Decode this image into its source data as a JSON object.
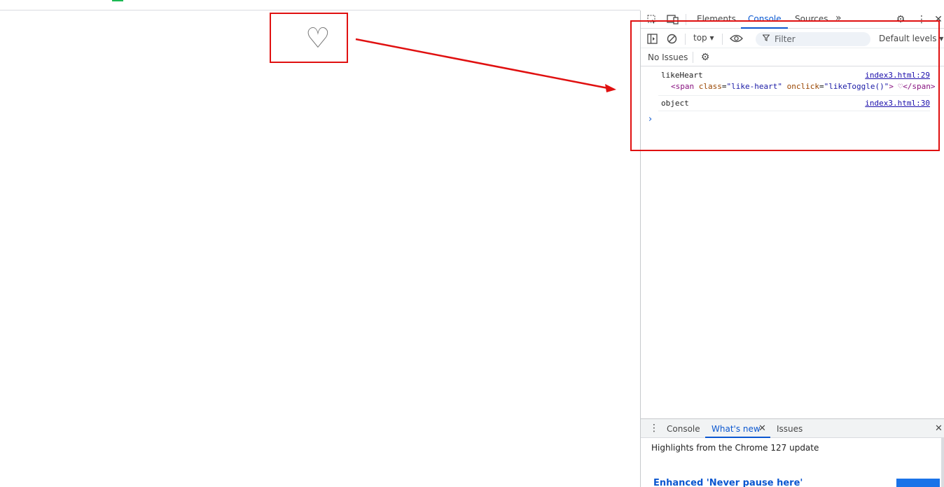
{
  "page": {
    "heart_glyph": "♡"
  },
  "devtools": {
    "tabs": [
      "Elements",
      "Console",
      "Sources"
    ],
    "active_tab": "Console",
    "more_tabs": "»",
    "toolbar": {
      "context": "top ▾",
      "filter_placeholder": "Filter",
      "levels": "Default levels ▾"
    },
    "issues_label": "No Issues",
    "messages": [
      {
        "text": "likeHeart",
        "source": "index3.html:29",
        "element": {
          "open_tag": "<span",
          "attr1_name": "class",
          "attr1_value": "\"like-heart\"",
          "attr2_name": "onclick",
          "attr2_value": "\"likeToggle()\"",
          "content": "> ♡",
          "close_tag": "</span>"
        }
      },
      {
        "text": "object",
        "source": "index3.html:30"
      }
    ],
    "prompt": "›"
  },
  "drawer": {
    "tabs": [
      "Console",
      "What's new",
      "Issues"
    ],
    "active_tab": "What's new",
    "highlights": "Highlights from the Chrome 127 update",
    "feature_title": "Enhanced 'Never pause here'"
  },
  "colors": {
    "annotation": "#e01010",
    "accent": "#0b57d0"
  }
}
